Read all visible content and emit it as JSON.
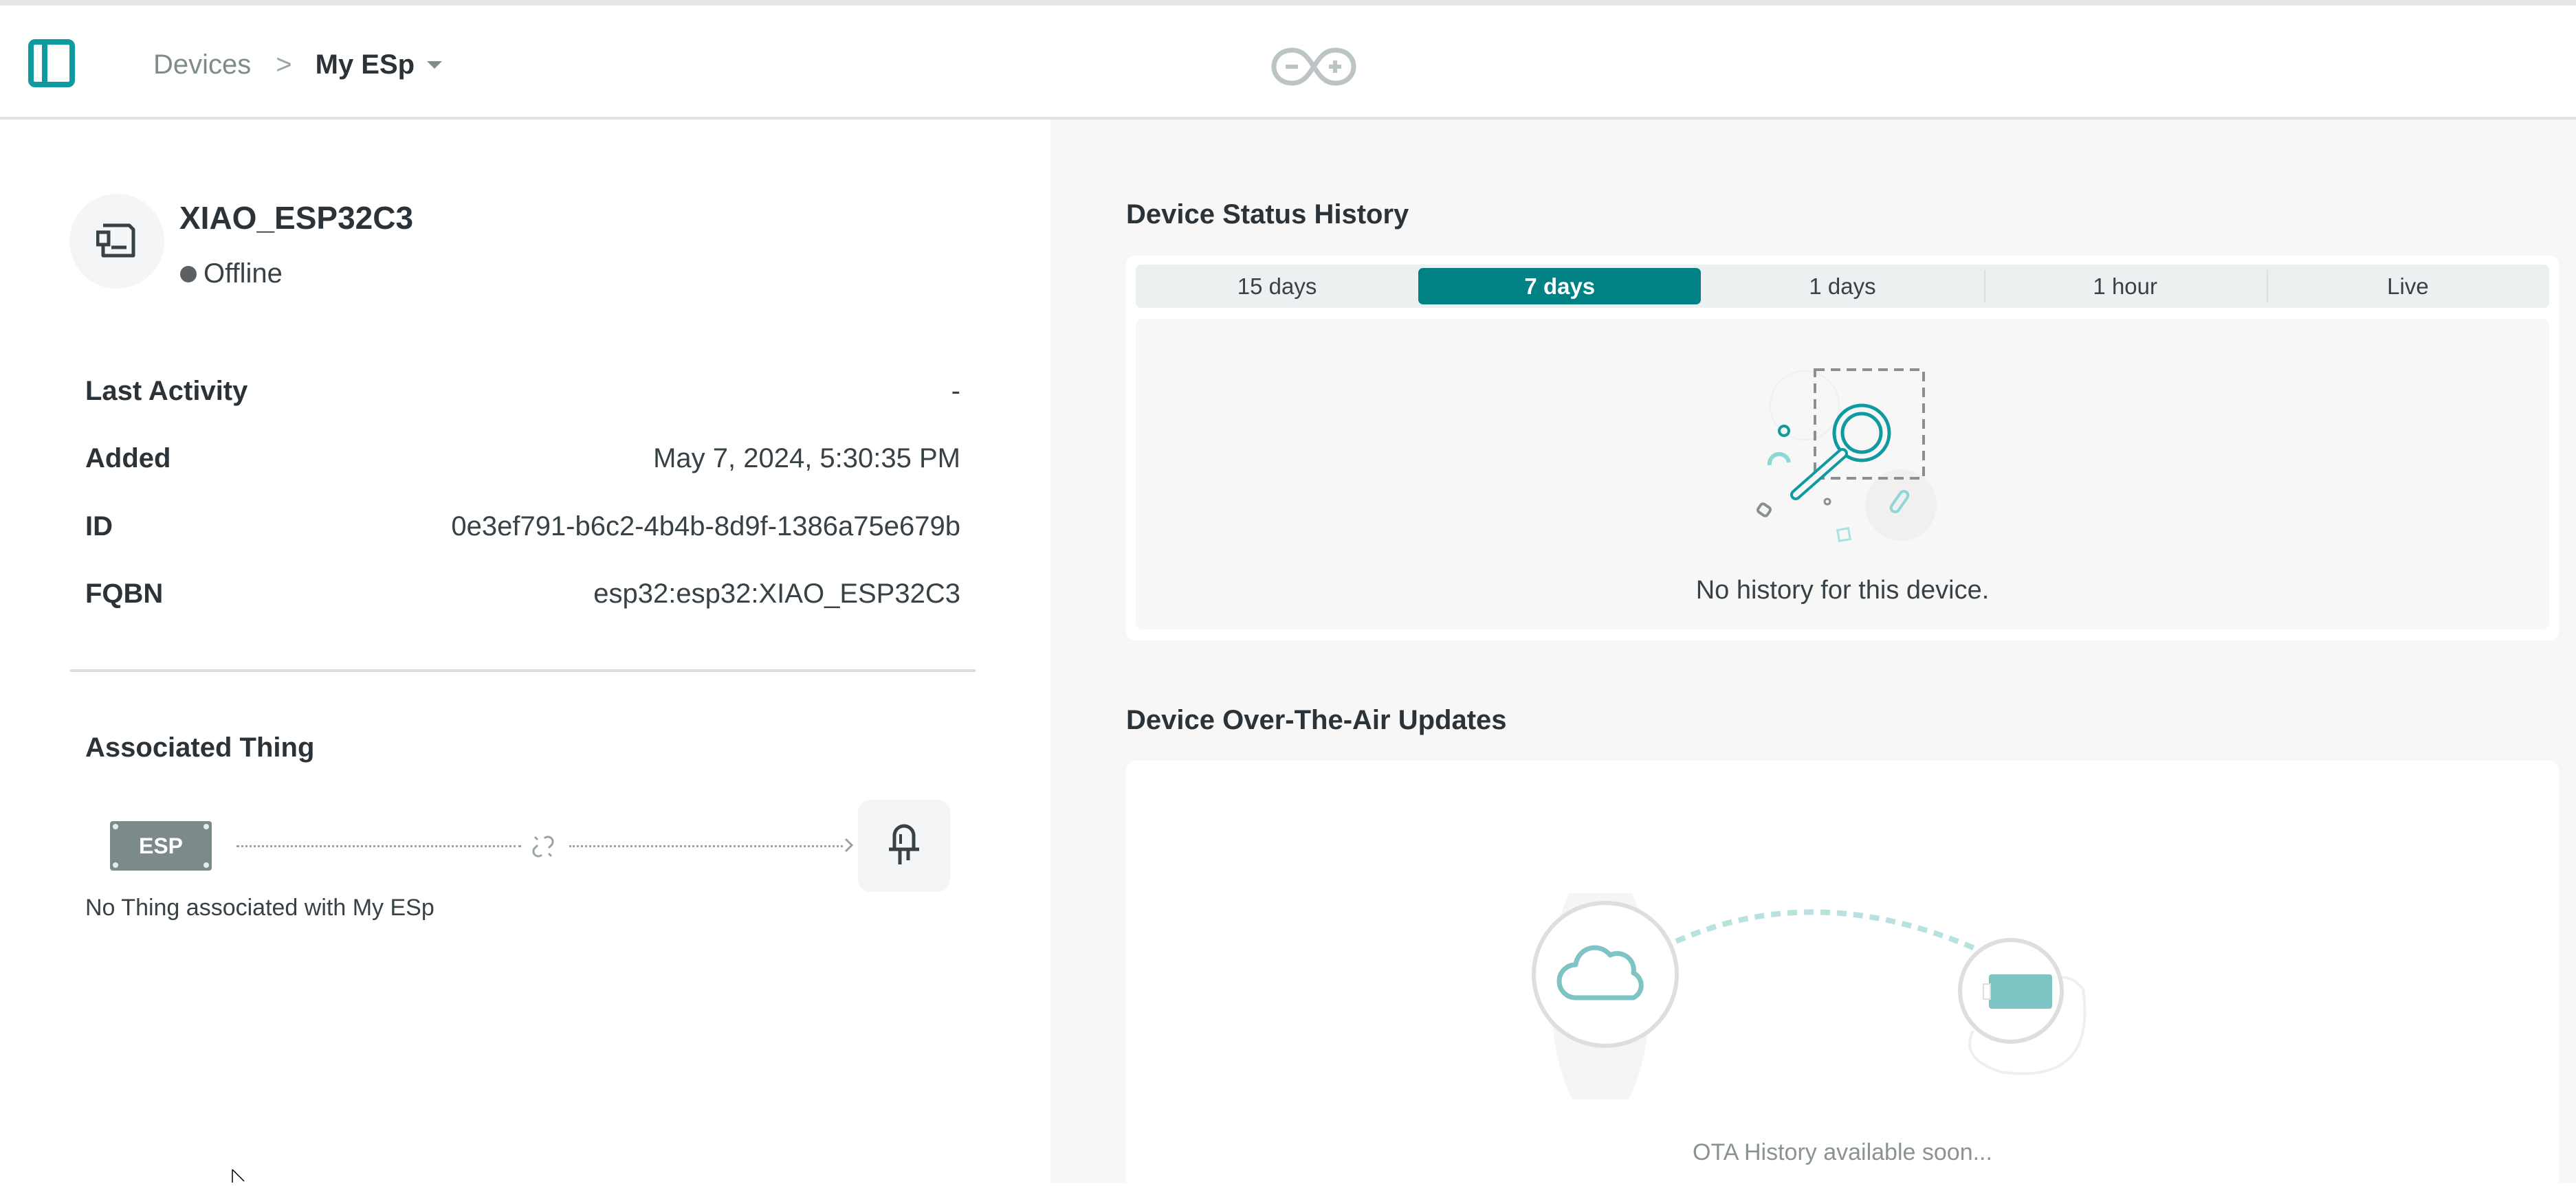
{
  "header": {
    "sidebar_toggle_icon": "sidebar-panel-icon",
    "breadcrumb": {
      "parent": "Devices",
      "separator": ">",
      "current": "My ESp"
    },
    "logo_icon": "arduino-infinity-logo"
  },
  "device": {
    "name": "XIAO_ESP32C3",
    "status": "Offline",
    "status_color": "#5a6064",
    "icon": "device-board-icon",
    "info": [
      {
        "label": "Last Activity",
        "value": "-"
      },
      {
        "label": "Added",
        "value": "May 7, 2024, 5:30:35 PM"
      },
      {
        "label": "ID",
        "value": "0e3ef791-b6c2-4b4b-8d9f-1386a75e679b"
      },
      {
        "label": "FQBN",
        "value": "esp32:esp32:XIAO_ESP32C3"
      }
    ]
  },
  "associated_thing": {
    "title": "Associated Thing",
    "chip_label": "ESP",
    "empty_message": "No Thing associated with My ESp",
    "thing_icon": "led-icon",
    "link_icon": "broken-link-icon"
  },
  "status_history": {
    "title": "Device Status History",
    "tabs": [
      {
        "label": "15 days",
        "active": false
      },
      {
        "label": "7 days",
        "active": true
      },
      {
        "label": "1 days",
        "active": false
      },
      {
        "label": "1 hour",
        "active": false
      },
      {
        "label": "Live",
        "active": false
      }
    ],
    "empty_message": "No history for this device.",
    "illustration": "magnifier-empty-illustration"
  },
  "ota": {
    "title": "Device Over-The-Air Updates",
    "message": "OTA History available soon...",
    "illustration": "cloud-to-device-illustration"
  },
  "colors": {
    "accent": "#008184",
    "accent_light": "#7fc4c5",
    "text_dark": "#2b3338",
    "muted": "#7f8c8d"
  }
}
